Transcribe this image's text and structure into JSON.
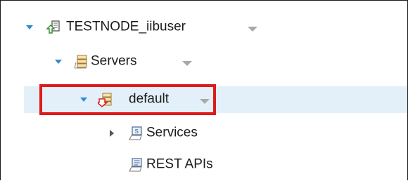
{
  "tree": {
    "nodes": [
      {
        "key": "node",
        "label": "TESTNODE_iibuser",
        "icon": "integration-node-icon",
        "expanded": true
      },
      {
        "key": "servers",
        "label": "Servers",
        "icon": "servers-folder-icon",
        "expanded": true
      },
      {
        "key": "default",
        "label": "default",
        "icon": "integration-server-icon",
        "expanded": true,
        "selected": true
      },
      {
        "key": "services",
        "label": "Services",
        "icon": "services-icon",
        "expanded": false
      },
      {
        "key": "restapis",
        "label": "REST APIs",
        "icon": "rest-apis-icon"
      }
    ]
  },
  "colors": {
    "selection_bg": "#e3f0f9",
    "highlight_border": "#e01a1a",
    "twisty_blue": "#2e8bd0",
    "caret_gray": "#a9a9a9"
  }
}
